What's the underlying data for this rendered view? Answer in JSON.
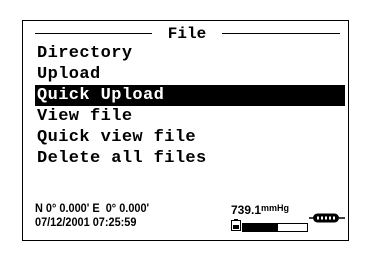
{
  "menu": {
    "title": "File",
    "items": [
      {
        "label": "Directory",
        "selected": false
      },
      {
        "label": "Upload",
        "selected": false
      },
      {
        "label": "Quick Upload",
        "selected": true
      },
      {
        "label": "View file",
        "selected": false
      },
      {
        "label": "Quick view file",
        "selected": false
      },
      {
        "label": "Delete all files",
        "selected": false
      }
    ]
  },
  "status": {
    "gps": "N 0° 0.000' E  0° 0.000'",
    "datetime": "07/12/2001 07:25:59",
    "pressure_value": "739.1",
    "pressure_unit": "mmHg",
    "battery_level": 0.55
  },
  "colors": {
    "background": "#ffffff",
    "foreground": "#000000",
    "highlight": "#000000"
  },
  "icons": [
    "battery-icon",
    "cable-connection-icon"
  ]
}
